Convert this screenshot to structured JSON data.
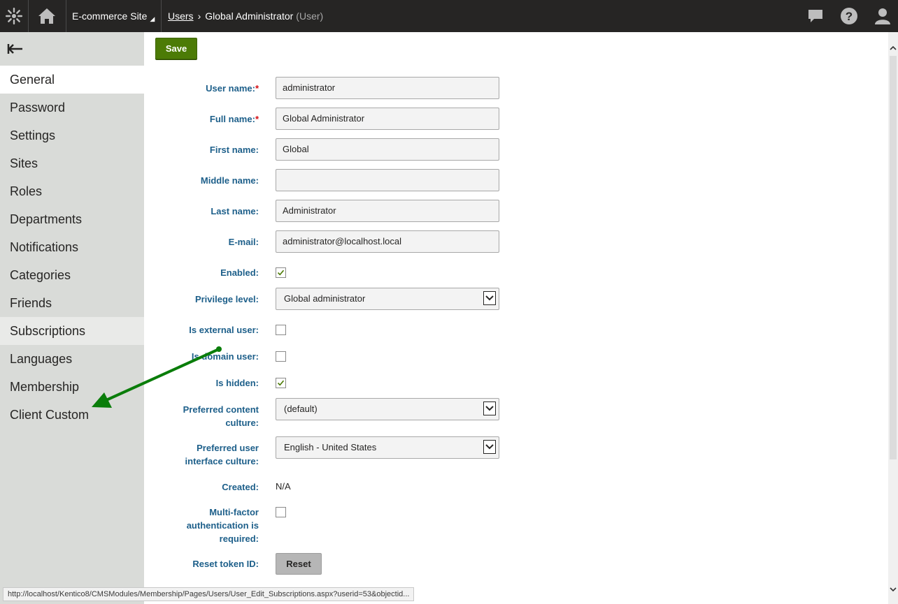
{
  "topbar": {
    "site_name": "E-commerce Site",
    "breadcrumb": {
      "link": "Users",
      "current": "Global Administrator",
      "type": "(User)"
    },
    "icons": [
      "kentico-logo-icon",
      "home-icon",
      "chat-icon",
      "help-icon",
      "user-icon"
    ]
  },
  "sidebar": {
    "items": [
      {
        "label": "General"
      },
      {
        "label": "Password"
      },
      {
        "label": "Settings"
      },
      {
        "label": "Sites"
      },
      {
        "label": "Roles"
      },
      {
        "label": "Departments"
      },
      {
        "label": "Notifications"
      },
      {
        "label": "Categories"
      },
      {
        "label": "Friends"
      },
      {
        "label": "Subscriptions"
      },
      {
        "label": "Languages"
      },
      {
        "label": "Membership"
      },
      {
        "label": "Client Custom"
      }
    ]
  },
  "toolbar": {
    "save_label": "Save"
  },
  "form": {
    "user_name": {
      "label": "User name:",
      "value": "administrator"
    },
    "full_name": {
      "label": "Full name:",
      "value": "Global Administrator"
    },
    "first_name": {
      "label": "First name:",
      "value": "Global"
    },
    "middle_name": {
      "label": "Middle name:",
      "value": ""
    },
    "last_name": {
      "label": "Last name:",
      "value": "Administrator"
    },
    "email": {
      "label": "E-mail:",
      "value": "administrator@localhost.local"
    },
    "enabled": {
      "label": "Enabled:",
      "checked": true
    },
    "privilege_level": {
      "label": "Privilege level:",
      "value": "Global administrator"
    },
    "is_external": {
      "label": "Is external user:",
      "checked": false
    },
    "is_domain": {
      "label": "Is domain user:",
      "checked": false
    },
    "is_hidden": {
      "label": "Is hidden:",
      "checked": true
    },
    "preferred_content_culture": {
      "label_line1": "Preferred content",
      "label_line2": "culture:",
      "value": "(default)"
    },
    "preferred_ui_culture": {
      "label_line1": "Preferred user",
      "label_line2": "interface culture:",
      "value": "English - United States"
    },
    "created": {
      "label": "Created:",
      "value": "N/A"
    },
    "mfa": {
      "label_line1": "Multi-factor",
      "label_line2": "authentication is",
      "label_line3": "required:",
      "checked": false
    },
    "reset_token": {
      "label": "Reset token ID:",
      "button": "Reset"
    },
    "required_marker": "*"
  },
  "status_bar": {
    "url": "http://localhost/Kentico8/CMSModules/Membership/Pages/Users/User_Edit_Subscriptions.aspx?userid=53&objectid..."
  },
  "colors": {
    "topbar": "#262524",
    "sidebar": "#d9dbd8",
    "label": "#1d5f8a",
    "save": "#4c7b06",
    "annotation_arrow": "#0a7d0a"
  }
}
